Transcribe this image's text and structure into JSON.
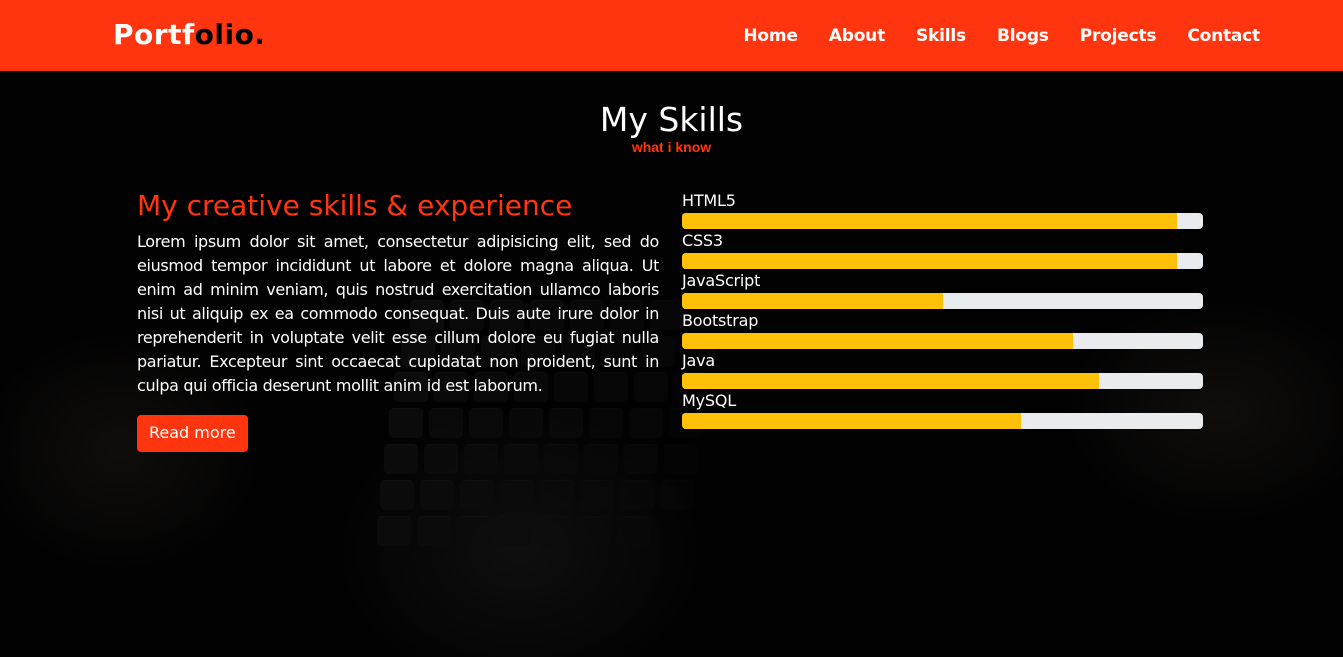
{
  "brand": {
    "logo_part1": "Portf",
    "logo_part2": "olio."
  },
  "nav": {
    "items": [
      {
        "label": "Home"
      },
      {
        "label": "About"
      },
      {
        "label": "Skills"
      },
      {
        "label": "Blogs"
      },
      {
        "label": "Projects"
      },
      {
        "label": "Contact"
      }
    ]
  },
  "skills_section": {
    "title": "My Skills",
    "subtitle": "what i know",
    "heading": "My creative skills & experience",
    "paragraph": "Lorem ipsum dolor sit amet, consectetur adipisicing elit, sed do eiusmod tempor incididunt ut labore et dolore magna aliqua. Ut enim ad minim veniam, quis nostrud exercitation ullamco laboris nisi ut aliquip ex ea commodo consequat. Duis aute irure dolor in reprehenderit in voluptate velit esse cillum dolore eu fugiat nulla pariatur. Excepteur sint occaecat cupidatat non proident, sunt in culpa qui officia deserunt mollit anim id est laborum.",
    "read_more_label": "Read more",
    "skills": [
      {
        "name": "HTML5",
        "level_percent": 95
      },
      {
        "name": "CSS3",
        "level_percent": 95
      },
      {
        "name": "JavaScript",
        "level_percent": 50
      },
      {
        "name": "Bootstrap",
        "level_percent": 75
      },
      {
        "name": "Java",
        "level_percent": 80
      },
      {
        "name": "MySQL",
        "level_percent": 65
      }
    ]
  },
  "colors": {
    "accent": "#ff350f",
    "progress_fill": "#ffc107",
    "progress_track": "#e9ecef",
    "background": "#000000"
  },
  "icons": {
    "background_image": "hands-on-keyboard-photo"
  }
}
